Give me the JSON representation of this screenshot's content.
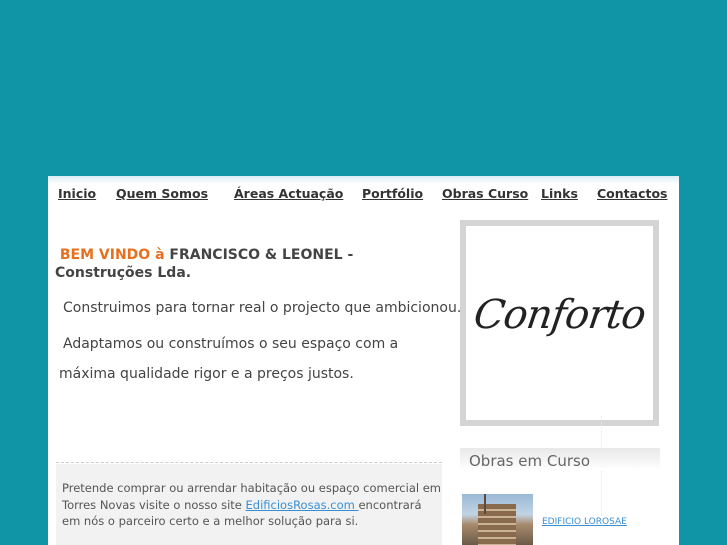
{
  "nav": {
    "items": [
      {
        "label": "Inicio"
      },
      {
        "label": "Quem Somos"
      },
      {
        "label": "Áreas Actuação"
      },
      {
        "label": "Portfólio"
      },
      {
        "label": "Obras Curso"
      },
      {
        "label": "Links"
      },
      {
        "label": "Contactos"
      }
    ]
  },
  "welcome": {
    "greeting": "BEM VINDO à",
    "company": "FRANCISCO & LEONEL - Construções Lda."
  },
  "content": {
    "p1": "Construimos para tornar real o projecto que ambicionou.",
    "p2": "Adaptamos ou construímos o seu espaço com a",
    "p3": "máxima qualidade rigor e a preços justos."
  },
  "promo": {
    "text_before": "Pretende comprar ou arrendar habitação ou espaço comercial em Torres Novas visite o nosso site ",
    "link": "EdificiosRosas.com ",
    "text_after": "encontrará em nós o parceiro certo e a melhor solução para si."
  },
  "sidebar": {
    "banner_text": "Conforto",
    "obras_heading": "Obras em Curso",
    "obra_link": "EDIFICIO LOROSAE"
  },
  "colors": {
    "background": "#0f95a5",
    "accent_orange": "#e6701e",
    "link_blue": "#3a8fd4"
  }
}
